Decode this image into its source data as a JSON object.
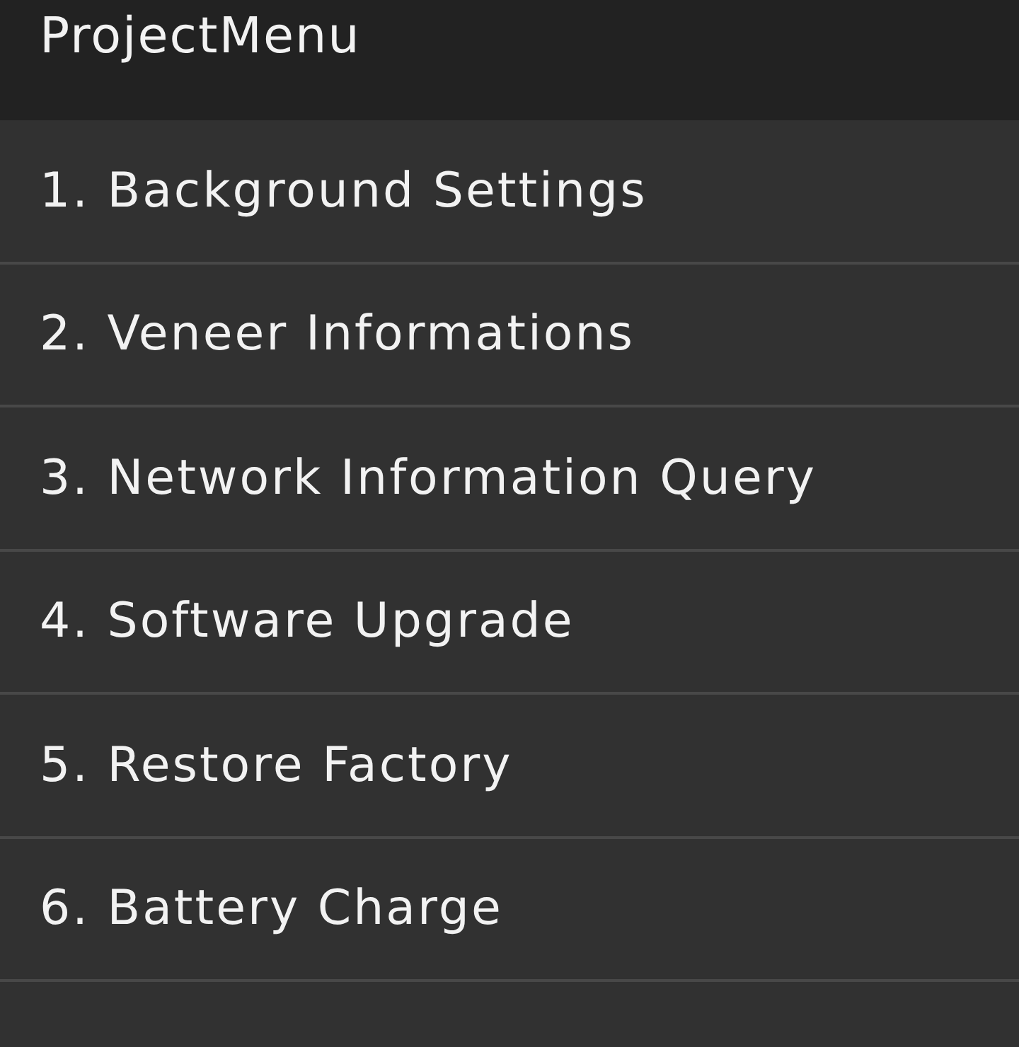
{
  "header": {
    "title": "ProjectMenu"
  },
  "menu_items": [
    {
      "label": "1. Background Settings"
    },
    {
      "label": "2. Veneer Informations"
    },
    {
      "label": "3. Network Information Query"
    },
    {
      "label": "4. Software Upgrade"
    },
    {
      "label": "5. Restore Factory"
    },
    {
      "label": "6. Battery Charge"
    }
  ]
}
